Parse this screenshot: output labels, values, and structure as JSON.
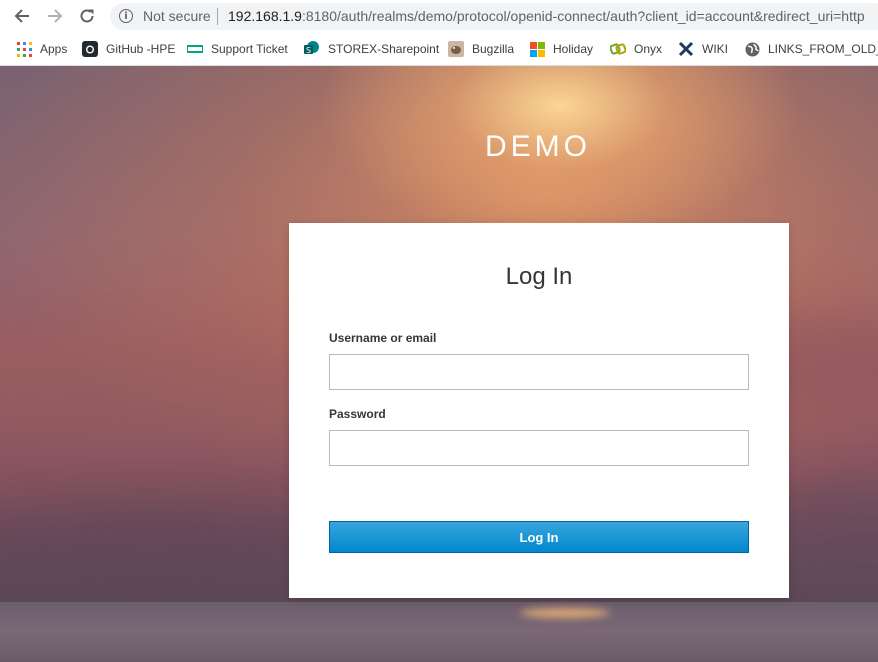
{
  "browser": {
    "security_label": "Not secure",
    "url_host": "192.168.1.9",
    "url_rest": ":8180/auth/realms/demo/protocol/openid-connect/auth?client_id=account&redirect_uri=http"
  },
  "bookmarks": [
    {
      "label": "Apps",
      "icon": "apps-grid-icon"
    },
    {
      "label": "GitHub -HPE",
      "icon": "github-icon"
    },
    {
      "label": "Support Ticket",
      "icon": "hpe-icon"
    },
    {
      "label": "STOREX-Sharepoint",
      "icon": "sharepoint-icon"
    },
    {
      "label": "Bugzilla",
      "icon": "bugzilla-icon"
    },
    {
      "label": "Holiday",
      "icon": "windows-icon"
    },
    {
      "label": "Onyx",
      "icon": "onyx-icon"
    },
    {
      "label": "WIKI",
      "icon": "wiki-icon"
    },
    {
      "label": "LINKS_FROM_OLD_...",
      "icon": "globe-icon"
    }
  ],
  "realm_name": "DEMO",
  "login": {
    "title": "Log In",
    "username_label": "Username or email",
    "username_value": "",
    "password_label": "Password",
    "password_value": "",
    "submit_label": "Log In"
  },
  "colors": {
    "button_top": "#39a5dc",
    "button_bottom": "#0088ce",
    "button_border": "#00659c"
  }
}
